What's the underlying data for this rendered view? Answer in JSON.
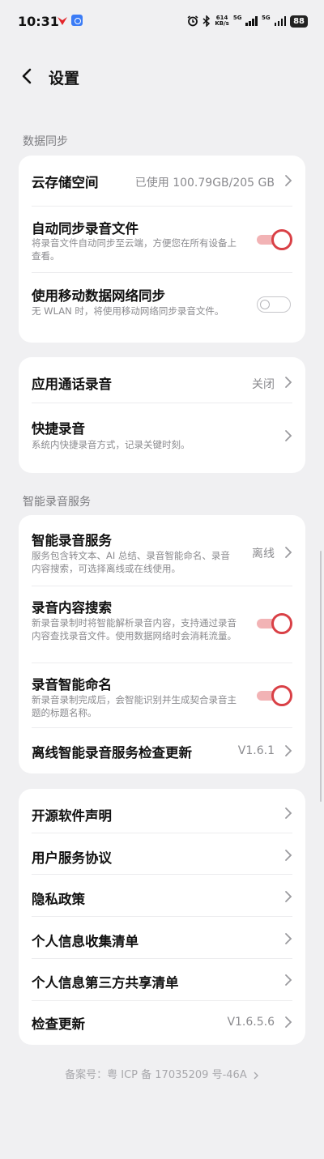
{
  "status_bar": {
    "time": "10:31",
    "speed_value": "614",
    "speed_unit": "KB/s",
    "network_1": "5G",
    "network_2": "5G",
    "battery": "88"
  },
  "header": {
    "title": "设置"
  },
  "sections": {
    "data_sync": "数据同步",
    "smart_service": "智能录音服务"
  },
  "cloud_storage": {
    "title": "云存储空间",
    "value": "已使用 100.79GB/205 GB"
  },
  "auto_sync": {
    "title": "自动同步录音文件",
    "subtitle": "将录音文件自动同步至云端，方便您在所有设备上查看。",
    "enabled": true
  },
  "mobile_sync": {
    "title": "使用移动数据网络同步",
    "subtitle": "无 WLAN 时，将使用移动网络同步录音文件。",
    "enabled": false
  },
  "call_recording": {
    "title": "应用通话录音",
    "value": "关闭"
  },
  "quick_record": {
    "title": "快捷录音",
    "subtitle": "系统内快捷录音方式，记录关键时刻。"
  },
  "smart_service": {
    "title": "智能录音服务",
    "subtitle": "服务包含转文本、AI 总结、录音智能命名、录音内容搜索，可选择离线或在线使用。",
    "value": "离线"
  },
  "content_search": {
    "title": "录音内容搜索",
    "subtitle": "新录音录制时将智能解析录音内容，支持通过录音内容查找录音文件。使用数据网络时会消耗流量。",
    "enabled": true
  },
  "smart_naming": {
    "title": "录音智能命名",
    "subtitle": "新录音录制完成后，会智能识别并生成契合录音主题的标题名称。",
    "enabled": true
  },
  "offline_update": {
    "title": "离线智能录音服务检查更新",
    "value": "V1.6.1"
  },
  "about": {
    "open_source": "开源软件声明",
    "user_agreement": "用户服务协议",
    "privacy": "隐私政策",
    "info_collection": "个人信息收集清单",
    "third_party": "个人信息第三方共享清单",
    "check_update": "检查更新",
    "version": "V1.6.5.6"
  },
  "footer": {
    "icp": "备案号：粤 ICP 备 17035209 号-46A"
  },
  "colors": {
    "accent": "#d94046",
    "background": "#f0f0f2",
    "card": "#ffffff"
  }
}
